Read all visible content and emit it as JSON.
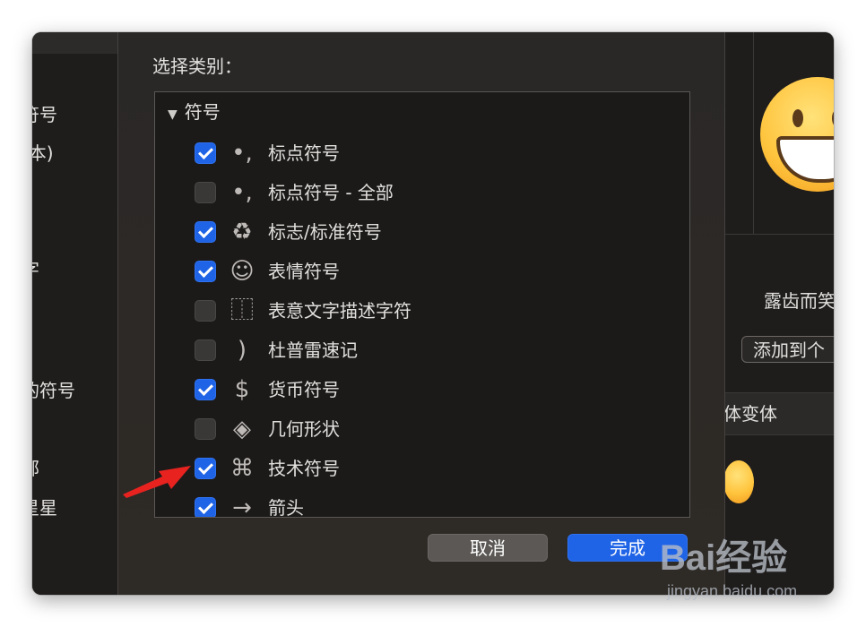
{
  "left_panel": {
    "items": [
      "符号",
      "(本)",
      "字",
      "的符号",
      "部",
      "星星"
    ]
  },
  "right_panel": {
    "emoji_name": "露齿而笑",
    "add_button": "添加到个",
    "variant_header": "体变体"
  },
  "dialog": {
    "title": "选择类别：",
    "group": {
      "label": "符号",
      "expanded": true
    },
    "items": [
      {
        "label": "标点符号",
        "checked": true,
        "icon": "punctuation-icon",
        "glyph": "•,",
        "shown": "on"
      },
      {
        "label": "标点符号 - 全部",
        "checked": false,
        "icon": "punctuation-icon",
        "glyph": "•,",
        "shown": "off"
      },
      {
        "label": "标志/标准符号",
        "checked": true,
        "icon": "recycle-icon",
        "glyph": "♻",
        "shown": "on"
      },
      {
        "label": "表情符号",
        "checked": true,
        "icon": "smiley-icon",
        "glyph": "☺",
        "shown": "on"
      },
      {
        "label": "表意文字描述字符",
        "checked": false,
        "icon": "ideographic-description-icon",
        "glyph": "⿰",
        "shown": "off"
      },
      {
        "label": "杜普雷速记",
        "checked": false,
        "icon": "duployan-icon",
        "glyph": ")",
        "shown": "off"
      },
      {
        "label": "货币符号",
        "checked": true,
        "icon": "dollar-icon",
        "glyph": "$",
        "shown": "on"
      },
      {
        "label": "几何形状",
        "checked": false,
        "icon": "diamond-icon",
        "glyph": "◈",
        "shown": "off"
      },
      {
        "label": "技术符号",
        "checked": true,
        "icon": "command-key-icon",
        "glyph": "⌘",
        "shown": "on"
      },
      {
        "label": "箭头",
        "checked": true,
        "icon": "arrow-right-icon",
        "glyph": "→",
        "shown": "on"
      }
    ],
    "cancel_label": "取消",
    "done_label": "完成"
  },
  "watermark": {
    "logo": "Bai经验",
    "url": "jingyan.baidu.com"
  },
  "colors": {
    "accent": "#1f63e6",
    "annotation_arrow": "#e8231f"
  }
}
